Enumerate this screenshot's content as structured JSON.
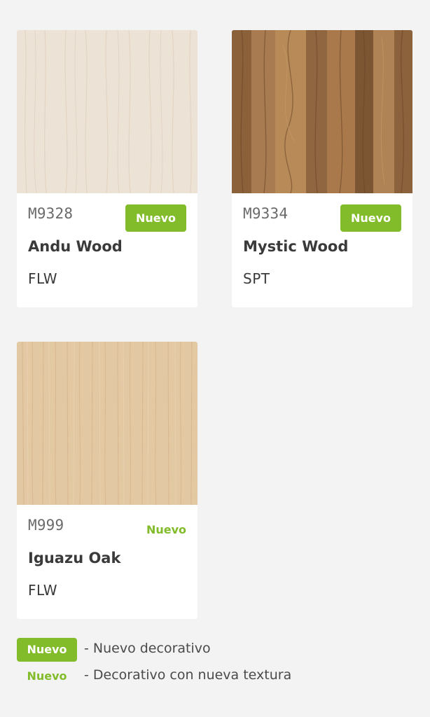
{
  "products": [
    {
      "code": "M9328",
      "badge": "Nuevo",
      "badge_style": "filled",
      "name": "Andu Wood",
      "finish": "FLW",
      "swatch_color": "#ece0d3"
    },
    {
      "code": "M9334",
      "badge": "Nuevo",
      "badge_style": "filled",
      "name": "Mystic Wood",
      "finish": "SPT",
      "swatch_color": "#9a6f46"
    },
    {
      "code": "M999",
      "badge": "Nuevo",
      "badge_style": "outline",
      "name": "Iguazu Oak",
      "finish": "FLW",
      "swatch_color": "#e2c7a3"
    }
  ],
  "legend": [
    {
      "badge": "Nuevo",
      "style": "filled",
      "text": "- Nuevo decorativo"
    },
    {
      "badge": "Nuevo",
      "style": "outline",
      "text": "- Decorativo con nueva textura"
    }
  ],
  "colors": {
    "accent_green": "#82bc2a",
    "background": "#f3f3f3",
    "card": "#ffffff"
  }
}
